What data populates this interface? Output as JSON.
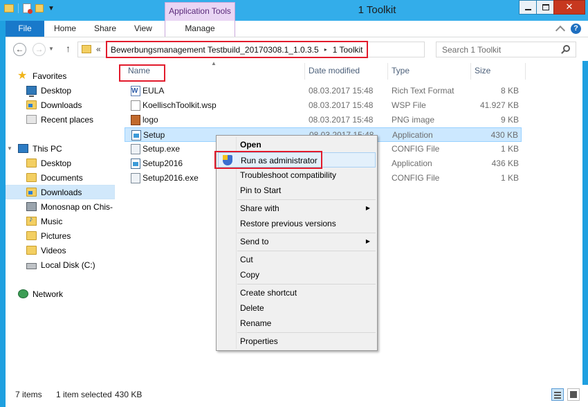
{
  "window": {
    "title": "1 Toolkit",
    "context_tab_group": "Application Tools"
  },
  "ribbon": {
    "tabs": [
      "File",
      "Home",
      "Share",
      "View",
      "Manage"
    ]
  },
  "address": {
    "prefix": "«",
    "crumbs": [
      "Bewerbungsmanagement Testbuild_20170308.1_1.0.3.5",
      "1 Toolkit"
    ],
    "crumb_separator": "▸",
    "search_placeholder": "Search 1 Toolkit"
  },
  "nav": {
    "items": [
      {
        "label": "Favorites",
        "icon": "star-icon"
      },
      {
        "label": "Desktop",
        "icon": "desktop-icon"
      },
      {
        "label": "Downloads",
        "icon": "downloads-folder-icon"
      },
      {
        "label": "Recent places",
        "icon": "recent-places-icon"
      },
      {
        "label": "This PC",
        "icon": "computer-icon"
      },
      {
        "label": "Desktop",
        "icon": "folder-icon"
      },
      {
        "label": "Documents",
        "icon": "folder-icon"
      },
      {
        "label": "Downloads",
        "icon": "downloads-folder-icon"
      },
      {
        "label": "Monosnap on Chis-",
        "icon": "network-drive-icon"
      },
      {
        "label": "Music",
        "icon": "music-folder-icon"
      },
      {
        "label": "Pictures",
        "icon": "folder-icon"
      },
      {
        "label": "Videos",
        "icon": "folder-icon"
      },
      {
        "label": "Local Disk (C:)",
        "icon": "disk-icon"
      },
      {
        "label": "Network",
        "icon": "network-icon"
      }
    ],
    "selected": "Downloads"
  },
  "columns": {
    "name": "Name",
    "date": "Date modified",
    "type": "Type",
    "size": "Size"
  },
  "files": [
    {
      "name": "EULA",
      "date": "08.03.2017 15:48",
      "type": "Rich Text Format",
      "size": "8 KB",
      "icon": "word-document-icon"
    },
    {
      "name": "KoellischToolkit.wsp",
      "date": "08.03.2017 15:48",
      "type": "WSP File",
      "size": "41.927 KB",
      "icon": "blank-file-icon"
    },
    {
      "name": "logo",
      "date": "08.03.2017 15:48",
      "type": "PNG image",
      "size": "9 KB",
      "icon": "image-file-icon"
    },
    {
      "name": "Setup",
      "date": "08.03.2017 15:48",
      "type": "Application",
      "size": "430 KB",
      "icon": "application-icon"
    },
    {
      "name": "Setup.exe",
      "date": "",
      "type": "CONFIG File",
      "size": "1 KB",
      "icon": "config-file-icon"
    },
    {
      "name": "Setup2016",
      "date": "",
      "type": "Application",
      "size": "436 KB",
      "icon": "application-icon"
    },
    {
      "name": "Setup2016.exe",
      "date": "",
      "type": "CONFIG File",
      "size": "1 KB",
      "icon": "config-file-icon"
    }
  ],
  "context_menu": {
    "items": [
      {
        "label": "Open",
        "bold": true
      },
      {
        "label": "Run as administrator",
        "icon": "uac-shield-icon"
      },
      {
        "label": "Troubleshoot compatibility"
      },
      {
        "label": "Pin to Start"
      },
      {
        "label": "Share with",
        "submenu": true
      },
      {
        "label": "Restore previous versions"
      },
      {
        "label": "Send to",
        "submenu": true
      },
      {
        "label": "Cut"
      },
      {
        "label": "Copy"
      },
      {
        "label": "Create shortcut"
      },
      {
        "label": "Delete"
      },
      {
        "label": "Rename"
      },
      {
        "label": "Properties"
      }
    ],
    "submenu_arrow": "▶"
  },
  "status": {
    "count": "7 items",
    "selection": "1 item selected",
    "selection_size": "430 KB"
  },
  "colors": {
    "titlebar": "#33adea",
    "file_tab": "#1979ca",
    "context_tab": "#e9d5f4",
    "highlight_box": "#e21b2c",
    "selection": "#cce8ff"
  }
}
